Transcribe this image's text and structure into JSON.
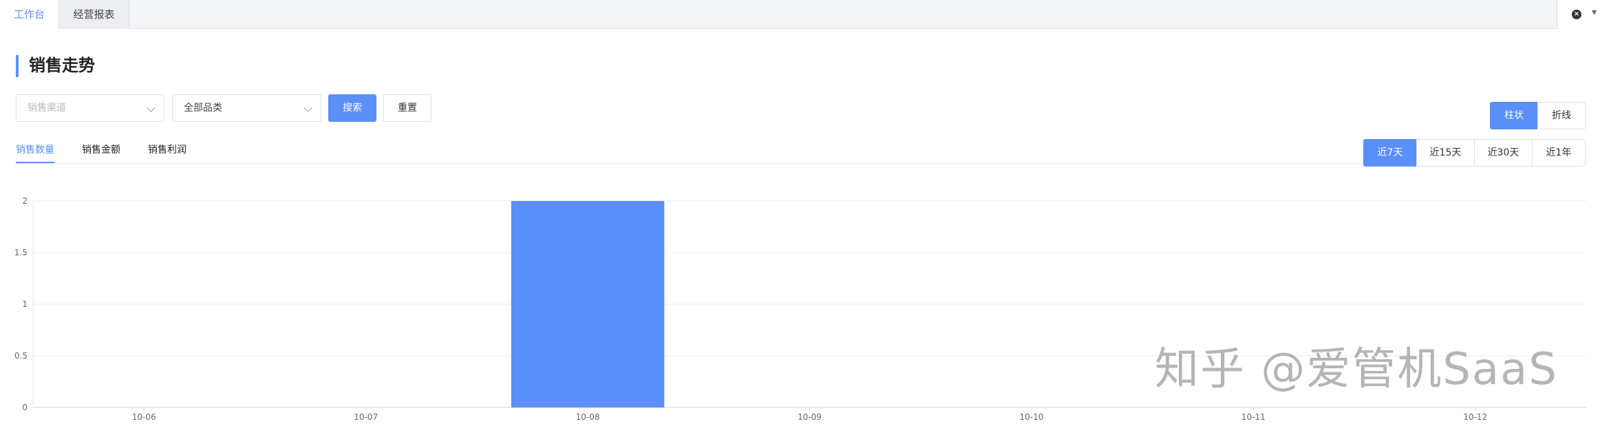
{
  "tabs": [
    {
      "label": "工作台",
      "active": true
    },
    {
      "label": "经营报表",
      "active": false
    }
  ],
  "window_controls": {
    "close_icon": "close-circle-icon"
  },
  "page_title": "销售走势",
  "filters": {
    "channel_placeholder": "销售渠道",
    "category_value": "全部品类",
    "search_label": "搜索",
    "reset_label": "重置"
  },
  "chart_type_toggle": [
    {
      "label": "柱状",
      "active": true
    },
    {
      "label": "折线",
      "active": false
    }
  ],
  "metric_tabs": [
    {
      "label": "销售数量",
      "active": true
    },
    {
      "label": "销售金额",
      "active": false
    },
    {
      "label": "销售利润",
      "active": false
    }
  ],
  "range_toggle": [
    {
      "label": "近7天",
      "active": true
    },
    {
      "label": "近15天",
      "active": false
    },
    {
      "label": "近30天",
      "active": false
    },
    {
      "label": "近1年",
      "active": false
    }
  ],
  "colors": {
    "accent": "#5b8ff9",
    "bar": "#5b8ff9"
  },
  "chart_data": {
    "type": "bar",
    "categories": [
      "10-06",
      "10-07",
      "10-08",
      "10-09",
      "10-10",
      "10-11",
      "10-12"
    ],
    "values": [
      0,
      0,
      2,
      0,
      0,
      0,
      0
    ],
    "yticks": [
      "0",
      "0.5",
      "1",
      "1.5",
      "2"
    ],
    "ylim": [
      0,
      2
    ],
    "grid": true
  },
  "watermark": "知乎 @爱管机SaaS"
}
